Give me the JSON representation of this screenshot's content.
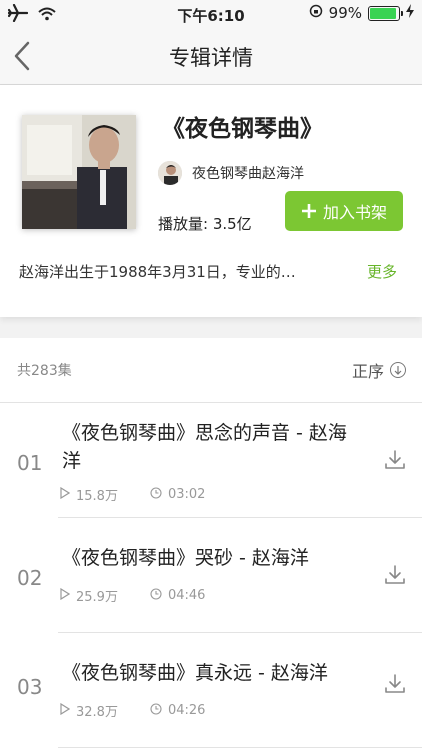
{
  "status_bar": {
    "time": "下午6:10",
    "battery": "99%",
    "battery_level": 0.99
  },
  "nav": {
    "title": "专辑详情"
  },
  "album": {
    "title": "《夜色钢琴曲》",
    "artist": "夜色钢琴曲赵海洋",
    "plays": "播放量: 3.5亿",
    "add_button": "加入书架",
    "description": "赵海洋出生于1988年3月31日，专业的…",
    "more": "更多"
  },
  "list": {
    "count": "共283集",
    "sort_label": "正序",
    "tracks": [
      {
        "num": "01",
        "name": "《夜色钢琴曲》思念的声音 - 赵海洋",
        "plays": "15.8万",
        "duration": "03:02"
      },
      {
        "num": "02",
        "name": "《夜色钢琴曲》哭砂 - 赵海洋",
        "plays": "25.9万",
        "duration": "04:46"
      },
      {
        "num": "03",
        "name": "《夜色钢琴曲》真永远 - 赵海洋",
        "plays": "32.8万",
        "duration": "04:26"
      }
    ]
  },
  "colors": {
    "accent_green": "#7cc733",
    "more_green": "#67b52a"
  }
}
